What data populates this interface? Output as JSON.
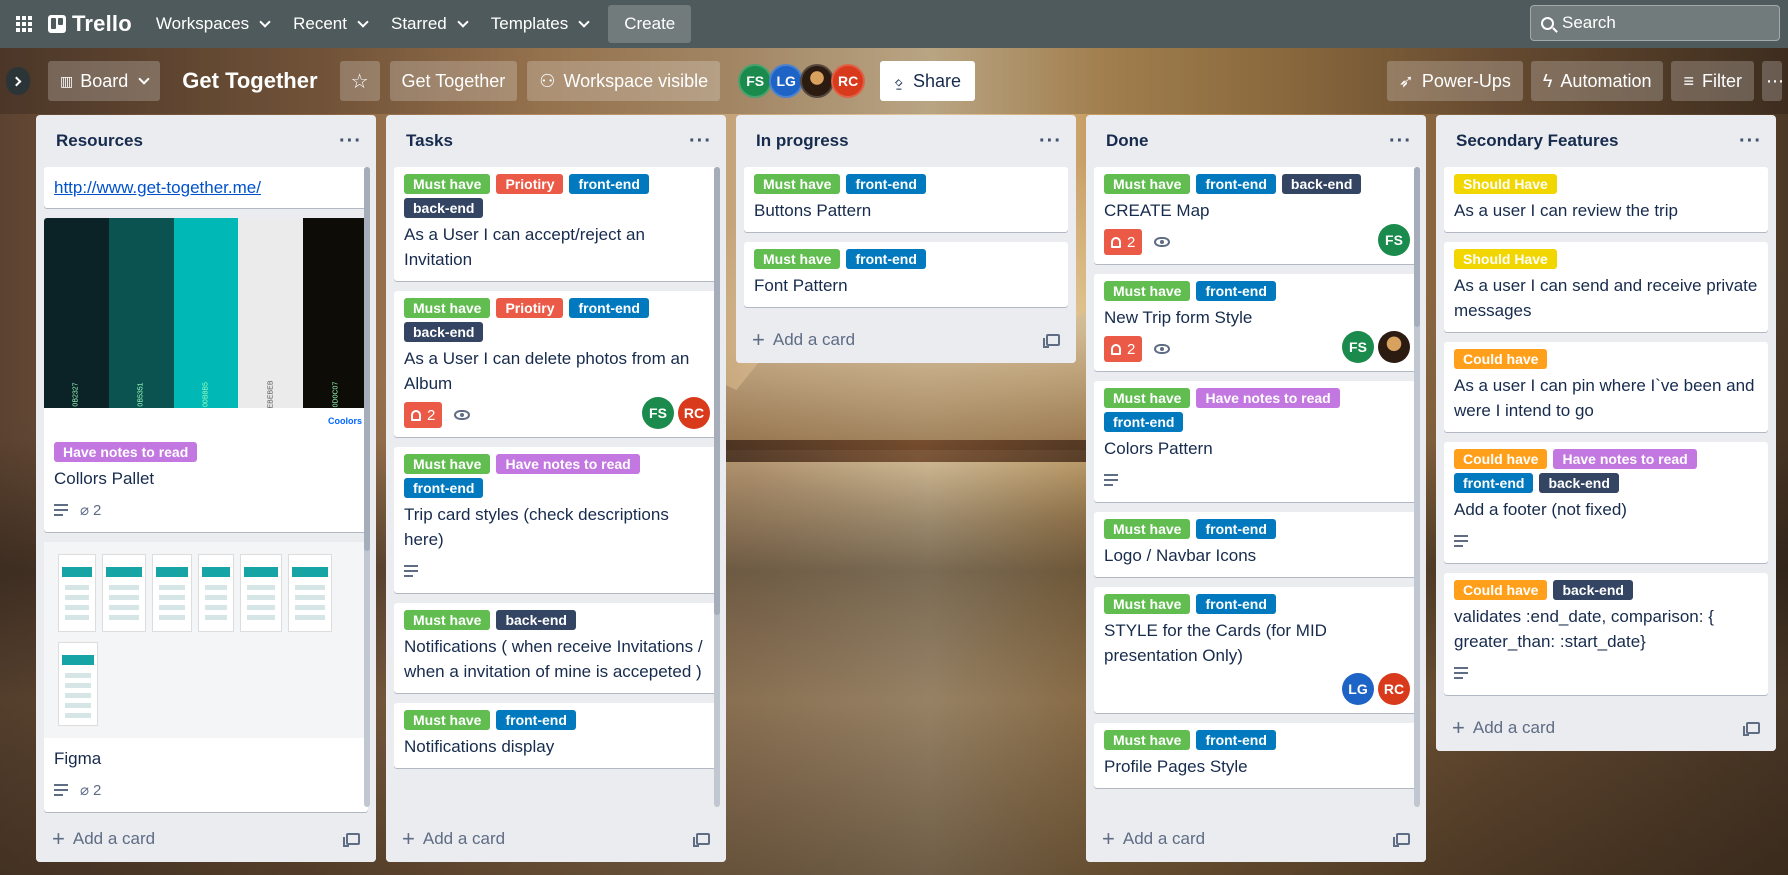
{
  "app": {
    "name": "Trello"
  },
  "topnav": {
    "menus": [
      "Workspaces",
      "Recent",
      "Starred",
      "Templates"
    ],
    "create_label": "Create",
    "search_placeholder": "Search"
  },
  "board": {
    "view_label": "Board",
    "title": "Get Together",
    "workspace_label": "Get Together",
    "visibility_label": "Workspace visible",
    "members": [
      {
        "initials": "FS",
        "color": "#1a8b4c"
      },
      {
        "initials": "LG",
        "color": "#1e63c6"
      },
      {
        "initials": "",
        "color": "#2b1b10"
      },
      {
        "initials": "RC",
        "color": "#d93a1b"
      }
    ],
    "share_label": "Share",
    "powerups_label": "Power-Ups",
    "automation_label": "Automation",
    "filter_label": "Filter"
  },
  "labels": {
    "must_have": "Must have",
    "priotiry": "Priotiry",
    "front_end": "front-end",
    "back_end": "back-end",
    "notes": "Have notes to read",
    "should_have": "Should Have",
    "could_have": "Could have"
  },
  "add_card_label": "Add a card",
  "lists": [
    {
      "title": "Resources",
      "cards": [
        {
          "title": "http://www.get-together.me/"
        },
        {
          "title": "Collors Pallet",
          "attachments": "2",
          "palette": [
            "#0b2327",
            "#0b5351",
            "#00b8b5",
            "#ebebeb",
            "#0d0c07"
          ],
          "palette_codes": [
            "0B2327",
            "0B5351",
            "00B8B5",
            "EBEBEB",
            "0D0C07"
          ],
          "palette_footer": "Coolors"
        },
        {
          "title": "Figma",
          "attachments": "2"
        }
      ]
    },
    {
      "title": "Tasks",
      "cards": [
        {
          "title": "As a User I can accept/reject an Invitation"
        },
        {
          "title": "As a User I can delete photos from an Album",
          "notifications": "2"
        },
        {
          "title": "Trip card styles (check descriptions here)"
        },
        {
          "title": "Notifications ( when receive Invitations / when a invitation of mine is accepeted )"
        },
        {
          "title": "Notifications display"
        }
      ]
    },
    {
      "title": "In progress",
      "cards": [
        {
          "title": "Buttons Pattern"
        },
        {
          "title": "Font Pattern"
        }
      ]
    },
    {
      "title": "Done",
      "cards": [
        {
          "title": "CREATE Map",
          "notifications": "2"
        },
        {
          "title": "New Trip form Style",
          "notifications": "2"
        },
        {
          "title": "Colors Pattern"
        },
        {
          "title": "Logo / Navbar Icons"
        },
        {
          "title": "STYLE for the Cards (for MID presentation Only)"
        },
        {
          "title": "Profile Pages Style"
        }
      ]
    },
    {
      "title": "Secondary Features",
      "cards": [
        {
          "title": "As a user I can review the trip"
        },
        {
          "title": "As a user I can send and receive private messages"
        },
        {
          "title": "As a user I can pin where I`ve been and were I intend to go"
        },
        {
          "title": "Add a footer (not fixed)"
        },
        {
          "title": "validates :end_date, comparison: { greater_than: :start_date}"
        }
      ]
    }
  ]
}
